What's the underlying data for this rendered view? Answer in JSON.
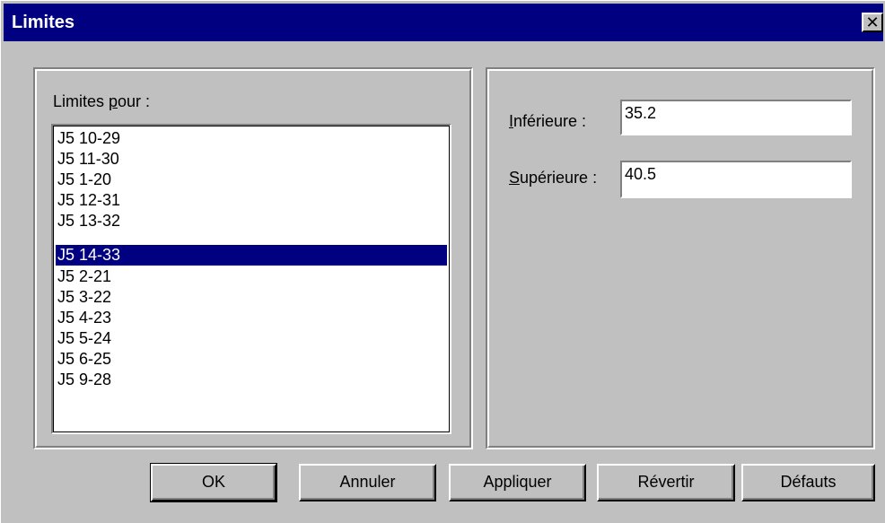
{
  "window": {
    "title": "Limites",
    "close_glyph": "✕"
  },
  "left_panel": {
    "label_prefix": "Limites ",
    "label_accel": "p",
    "label_suffix": "our :",
    "list_items": [
      "J5 10-29",
      "J5 11-30",
      "J5 1-20",
      "J5 12-31",
      "J5 13-32",
      "J5 14-33",
      "J5 2-21",
      "J5 3-22",
      "J5 4-23",
      "J5 5-24",
      "J5 6-25",
      "J5 9-28"
    ],
    "selected_index": 5
  },
  "right_panel": {
    "lower_label_accel": "I",
    "lower_label_rest": "nférieure :",
    "lower_value": "35.2",
    "upper_label_accel": "S",
    "upper_label_rest": "upérieure :",
    "upper_value": "40.5"
  },
  "buttons": {
    "ok": "OK",
    "cancel": "Annuler",
    "apply": "Appliquer",
    "revert": "Révertir",
    "defaults": "Défauts"
  },
  "colors": {
    "title_bar": "#000080",
    "selection": "#000080",
    "face": "#c0c0c0"
  }
}
